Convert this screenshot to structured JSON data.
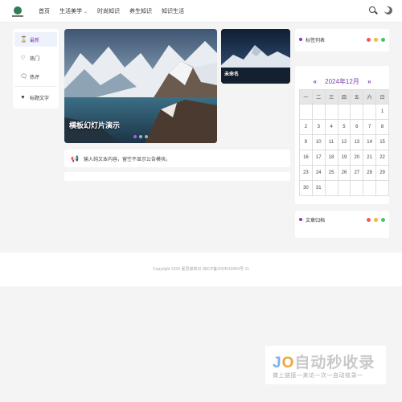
{
  "nav": {
    "items": [
      {
        "label": "首页"
      },
      {
        "label": "生活美学",
        "has_dropdown": true
      },
      {
        "label": "时尚知识"
      },
      {
        "label": "养生知识"
      },
      {
        "label": "知识生活"
      }
    ],
    "icons": [
      "search-icon",
      "moon-icon"
    ]
  },
  "categories": [
    {
      "label": "最新",
      "icon": "hourglass-icon",
      "active": true
    },
    {
      "label": "热门",
      "icon": "heart-pulse-icon",
      "active": false
    },
    {
      "label": "热评",
      "icon": "comment-icon",
      "active": false
    },
    {
      "label": "标题文字",
      "icon": "heart-icon",
      "active": false
    }
  ],
  "hero": {
    "title": "横板幻灯片演示",
    "slides_count": 3,
    "active_slide": 1
  },
  "side_feature": {
    "title": "未命名"
  },
  "notice": {
    "text": "输入纯文本内容，留空不显示公告模块。",
    "icon": "megaphone-icon"
  },
  "widgets": {
    "tags": {
      "title": "标签列表"
    },
    "archive": {
      "title": "文章归档"
    },
    "lights": [
      "#f25c5c",
      "#f6b73c",
      "#4cc16f"
    ]
  },
  "calendar": {
    "title": "2024年12月",
    "prev": "«",
    "next": "»",
    "weekdays": [
      "一",
      "二",
      "三",
      "四",
      "五",
      "六",
      "日"
    ],
    "weeks": [
      [
        "",
        "",
        "",
        "",
        "",
        "",
        "1"
      ],
      [
        "2",
        "3",
        "4",
        "5",
        "6",
        "7",
        "8"
      ],
      [
        "9",
        "10",
        "11",
        "12",
        "13",
        "14",
        "15"
      ],
      [
        "16",
        "17",
        "18",
        "19",
        "20",
        "21",
        "22"
      ],
      [
        "23",
        "24",
        "25",
        "26",
        "27",
        "28",
        "29"
      ],
      [
        "30",
        "31",
        "",
        "",
        "",
        "",
        ""
      ]
    ]
  },
  "footer": {
    "text": "Copyright 2024   夏思做知识    琼ICP备2024018459号-11"
  },
  "watermark": {
    "brand_j": "J",
    "brand_o": "O",
    "brand_rest": "自动秒收录",
    "sub": "做上链接一来访一次一自动收录一"
  },
  "colors": {
    "accent": "#7a3fb0",
    "active_bg": "#eef2fb"
  }
}
